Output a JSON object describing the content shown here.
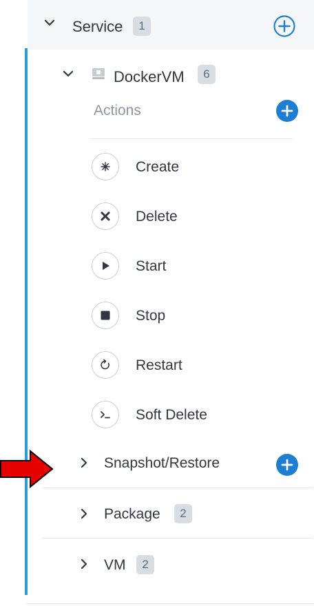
{
  "service": {
    "label": "Service",
    "count": "1"
  },
  "dockervm": {
    "label": "DockerVM",
    "count": "6"
  },
  "actions": {
    "label": "Actions",
    "items": [
      {
        "label": "Create",
        "icon": "create-icon"
      },
      {
        "label": "Delete",
        "icon": "delete-icon"
      },
      {
        "label": "Start",
        "icon": "start-icon"
      },
      {
        "label": "Stop",
        "icon": "stop-icon"
      },
      {
        "label": "Restart",
        "icon": "restart-icon"
      },
      {
        "label": "Soft Delete",
        "icon": "terminal-icon"
      }
    ]
  },
  "groups": {
    "snapshot": {
      "label": "Snapshot/Restore"
    },
    "package": {
      "label": "Package",
      "count": "2"
    },
    "vm": {
      "label": "VM",
      "count": "2"
    }
  },
  "colors": {
    "accent": "#2d9cdb",
    "add_button": "#1d7fd4",
    "arrow": "#e60000",
    "text": "#303740",
    "muted": "#8a96a3"
  }
}
